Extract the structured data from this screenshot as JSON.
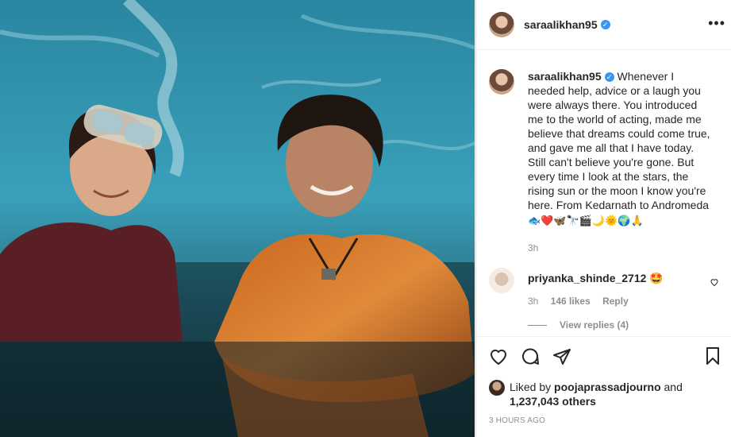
{
  "post": {
    "username": "saraalikhan95",
    "verified_badge": "✓",
    "more_icon": "•••"
  },
  "caption": {
    "username": "saraalikhan95",
    "text": "Whenever I needed help, advice or a laugh you were always there. You introduced me to the world of acting, made me believe that dreams could come true, and gave me all that I have today. Still can't believe you're gone. But every time I look at the stars, the rising sun or the moon I know you're here. From Kedarnath to Andromeda",
    "emojis": "🐟❤️🦋🔭🎬🌙🌞🌍🙏",
    "time": "3h"
  },
  "comment": {
    "username": "priyanka_shinde_2712",
    "emoji": "🤩",
    "time": "3h",
    "likes": "146 likes",
    "reply": "Reply"
  },
  "view_replies": "View replies (4)",
  "likes": {
    "prefix": "Liked by",
    "user": "poojaprassadjourno",
    "suffix": "and",
    "count": "1,237,043 others"
  },
  "timestamp": "3 HOURS AGO",
  "icons": [
    "heart-icon",
    "comment-icon",
    "share-icon",
    "bookmark-icon",
    "more-icon",
    "verified-icon"
  ]
}
